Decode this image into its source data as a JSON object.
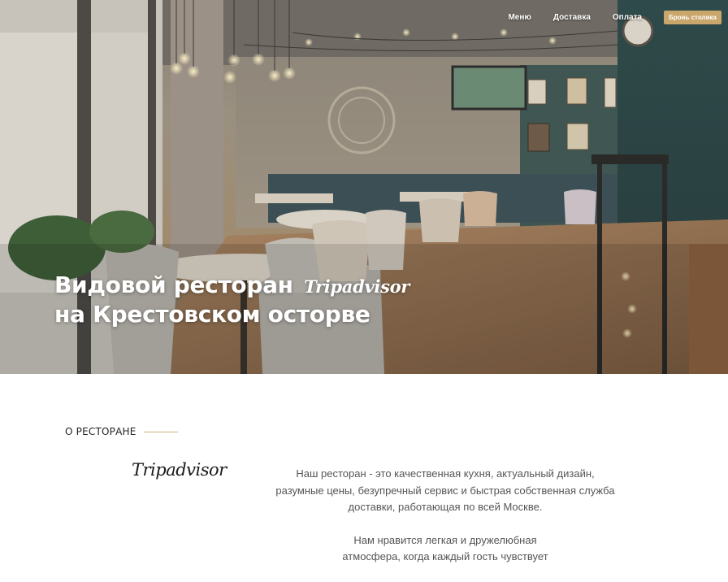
{
  "nav": {
    "items": [
      "Меню",
      "Доставка",
      "Оплата"
    ],
    "book_label": "Бронь столика"
  },
  "hero": {
    "title_line1": "Видовой ресторан",
    "title_script": "Tripadvisor",
    "title_line2": "на Крестовском осторве"
  },
  "about": {
    "section_label": "О РЕСТОРАНЕ",
    "logo_text": "Tripadvisor",
    "paragraph1_lines": [
      "Наш ресторан - это качественная кухня, актуальный дизайн,",
      "разумные цены, безупречный сервис и быстрая собственная служба",
      "доставки, работающая по всей Москве."
    ],
    "paragraph2_lines": [
      "Нам нравится легкая и дружелюбная",
      "атмосфера, когда каждый гость чувствует"
    ]
  },
  "colors": {
    "accent": "#c9a66b",
    "label_line": "#c9b27c",
    "body_text": "#555555"
  }
}
